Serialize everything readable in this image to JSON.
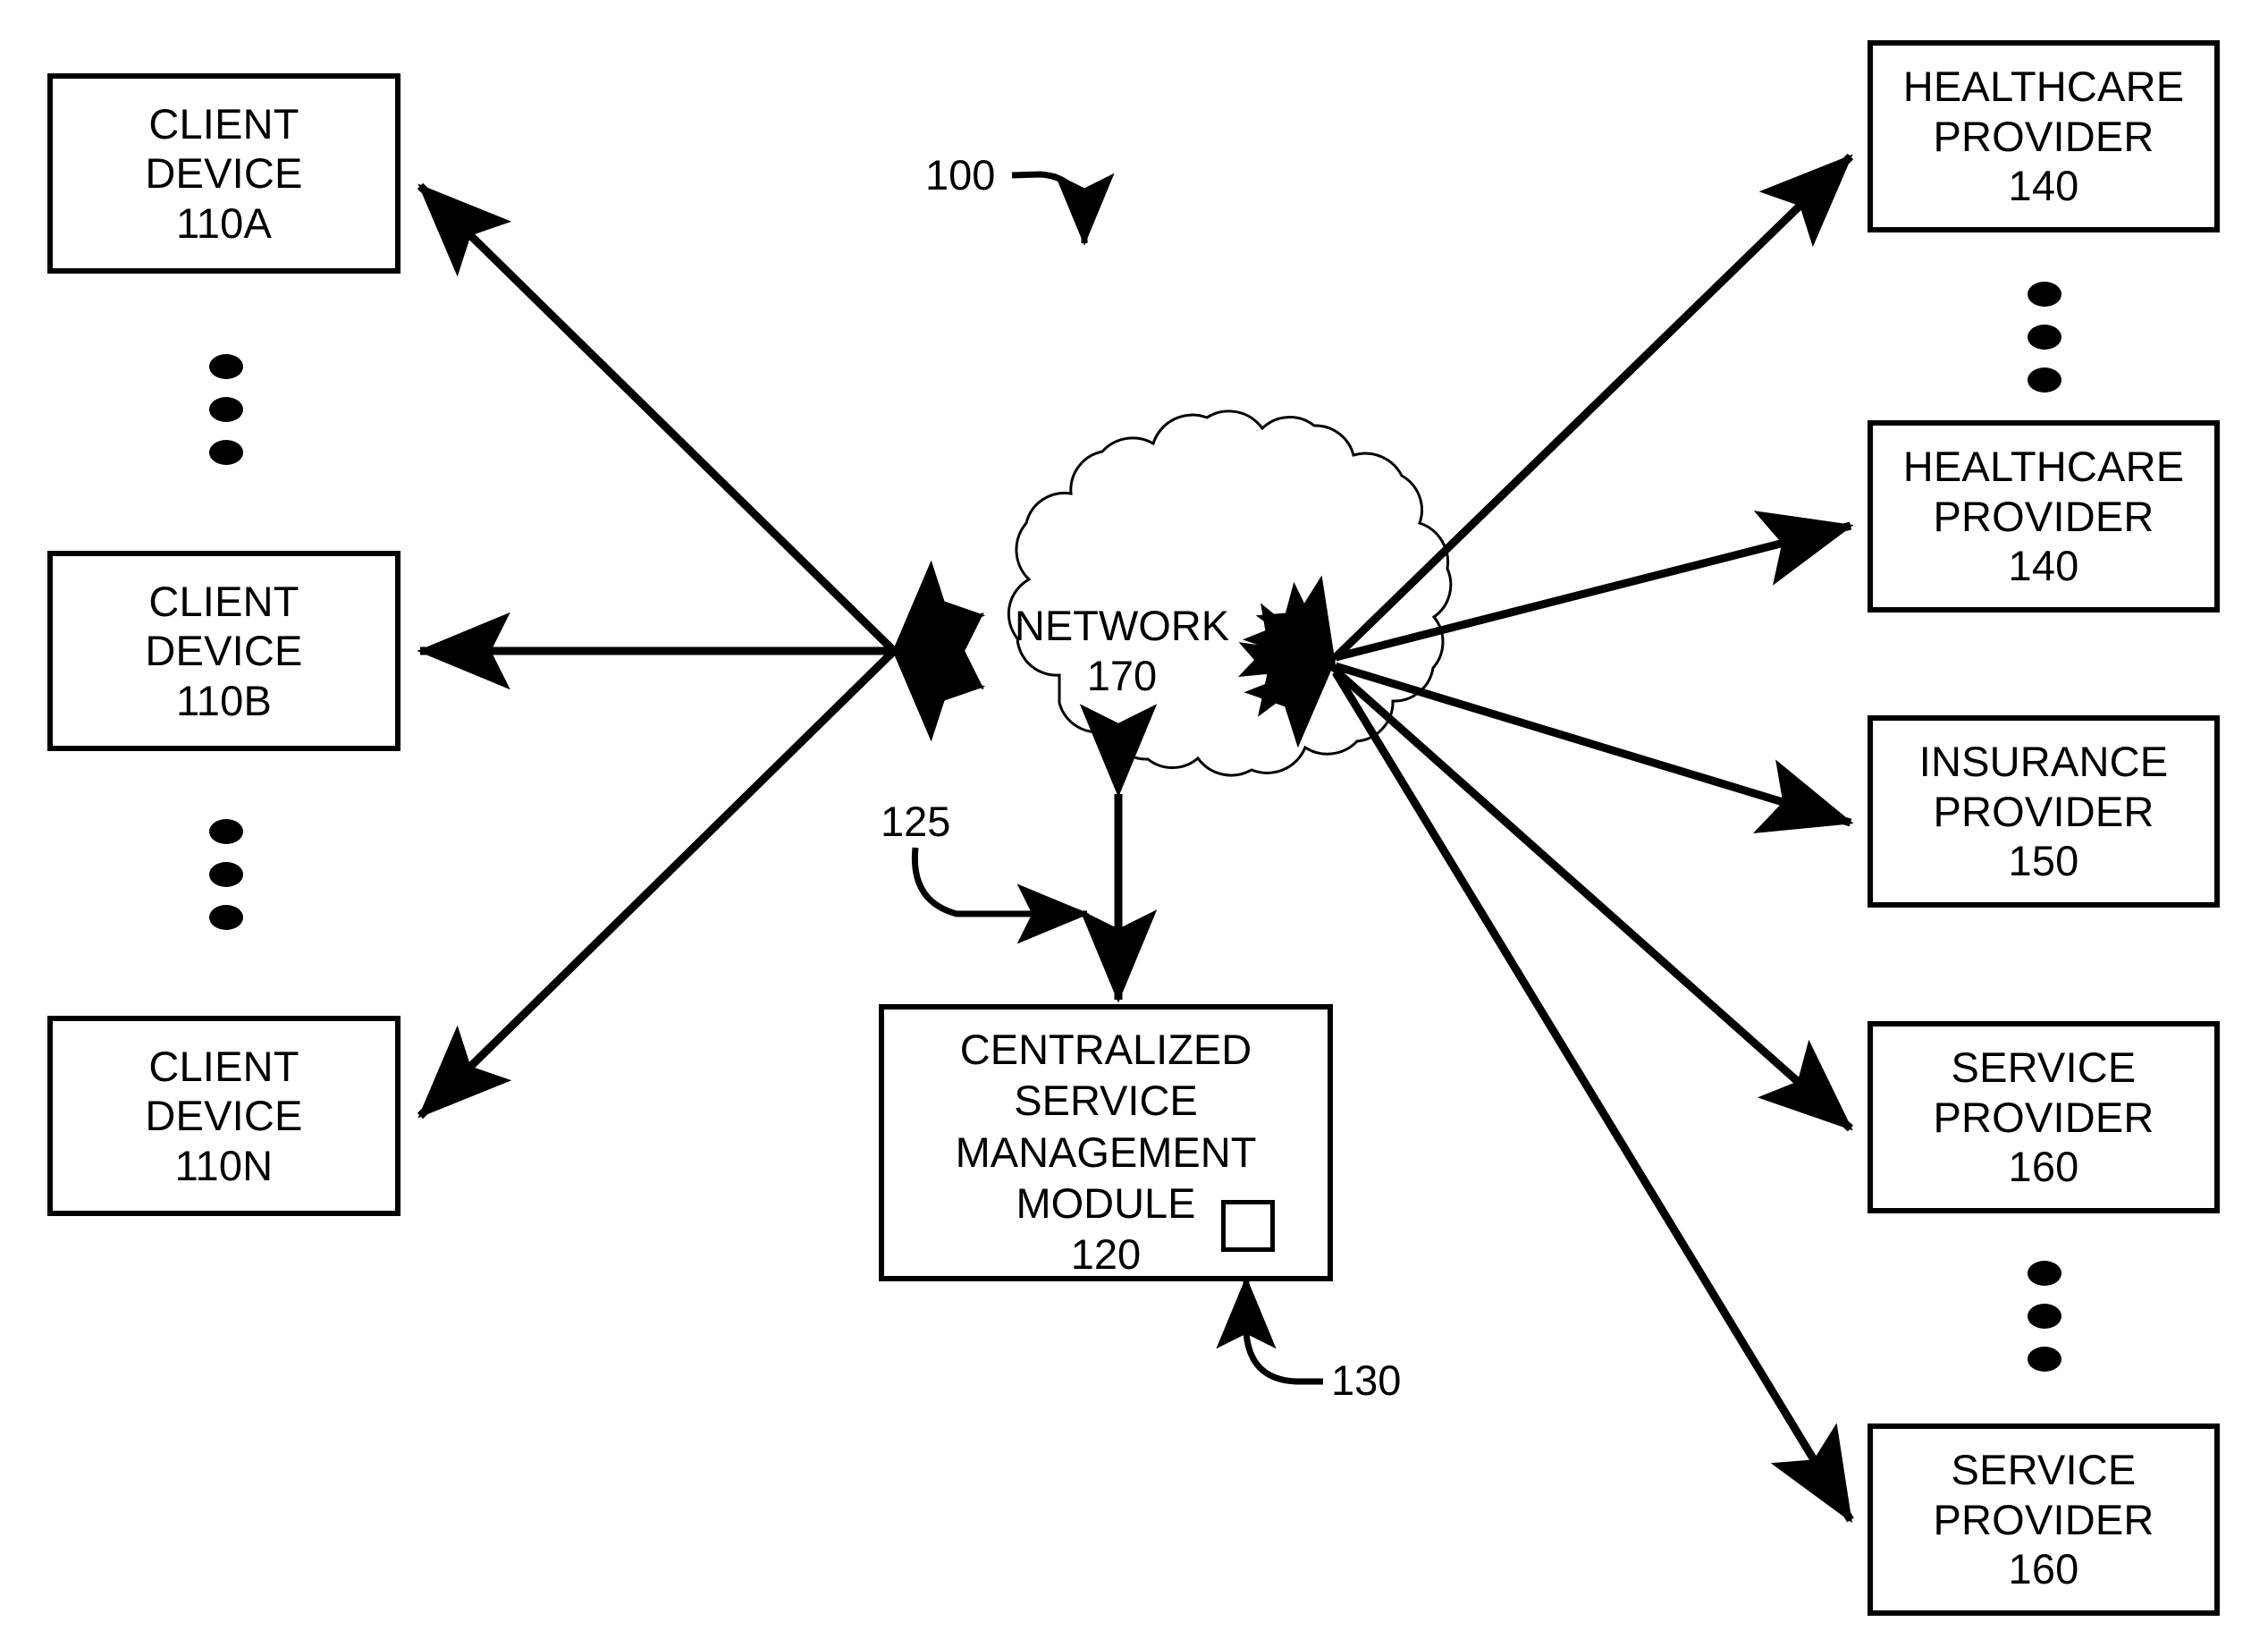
{
  "figure": {
    "ref_100": "100",
    "ref_125": "125",
    "ref_130": "130"
  },
  "clients": [
    {
      "line1": "CLIENT",
      "line2": "DEVICE",
      "line3": "110A"
    },
    {
      "line1": "CLIENT",
      "line2": "DEVICE",
      "line3": "110B"
    },
    {
      "line1": "CLIENT",
      "line2": "DEVICE",
      "line3": "110N"
    }
  ],
  "network": {
    "line1": "NETWORK",
    "line2": "170"
  },
  "module": {
    "line1": "CENTRALIZED",
    "line2": "SERVICE",
    "line3": "MANAGEMENT",
    "line4": "MODULE",
    "line5": "120"
  },
  "providers": [
    {
      "line1": "HEALTHCARE",
      "line2": "PROVIDER",
      "line3": "140"
    },
    {
      "line1": "HEALTHCARE",
      "line2": "PROVIDER",
      "line3": "140"
    },
    {
      "line1": "INSURANCE",
      "line2": "PROVIDER",
      "line3": "150"
    },
    {
      "line1": "SERVICE",
      "line2": "PROVIDER",
      "line3": "160"
    },
    {
      "line1": "SERVICE",
      "line2": "PROVIDER",
      "line3": "160"
    }
  ],
  "colors": {
    "stroke": "#000000",
    "background": "#ffffff"
  }
}
